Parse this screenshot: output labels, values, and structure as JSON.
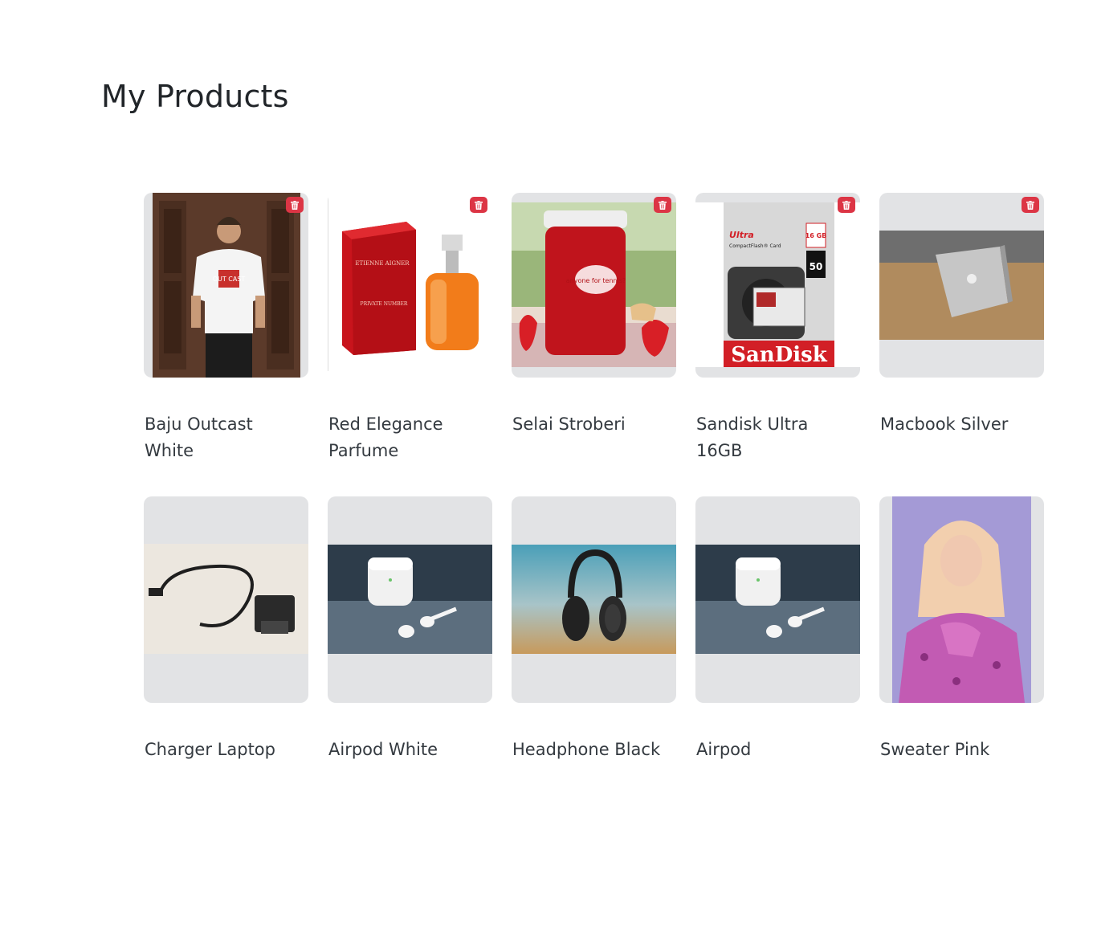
{
  "page": {
    "title": "My Products"
  },
  "products": [
    {
      "name": "Baju Outcast White",
      "image": "person-tshirt-image",
      "deletable": true
    },
    {
      "name": "Red Elegance Parfume",
      "image": "perfume-bottle-image",
      "deletable": true
    },
    {
      "name": "Selai Stroberi",
      "image": "strawberry-jam-image",
      "deletable": true
    },
    {
      "name": "Sandisk Ultra 16GB",
      "image": "sandisk-card-image",
      "deletable": true
    },
    {
      "name": "Macbook Silver",
      "image": "macbook-image",
      "deletable": true
    },
    {
      "name": "Charger Laptop",
      "image": "charger-cable-image",
      "deletable": false
    },
    {
      "name": "Airpod White",
      "image": "airpods-image",
      "deletable": false
    },
    {
      "name": "Headphone Black",
      "image": "headphone-image",
      "deletable": false
    },
    {
      "name": "Airpod",
      "image": "airpods-image",
      "deletable": false
    },
    {
      "name": "Sweater Pink",
      "image": "person-sweater-image",
      "deletable": false
    }
  ],
  "images": {
    "jar_text": "anyone for tennis?",
    "perfume_brand": "ETIENNE AIGNER",
    "perfume_name": "PRIVATE NUMBER",
    "sandisk_brand": "SanDisk",
    "sandisk_product": "Ultra",
    "sandisk_cf": "CompactFlash® Card",
    "sandisk_capacity": "16 GB",
    "sandisk_speed": "50",
    "tshirt_text": "OUT CAST"
  },
  "colors": {
    "delete_button": "#dc3545",
    "thumb_bg": "#e2e3e5",
    "text": "#343a40"
  },
  "icons": {
    "delete": "trash-icon"
  }
}
